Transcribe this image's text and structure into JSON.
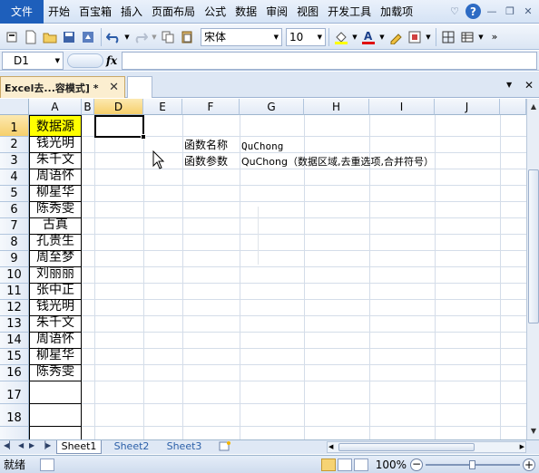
{
  "menu": {
    "file": "文件",
    "items": [
      "开始",
      "百宝箱",
      "插入",
      "页面布局",
      "公式",
      "数据",
      "审阅",
      "视图",
      "开发工具",
      "加载项"
    ]
  },
  "toolbar": {
    "font_name": "宋体",
    "font_size": "10"
  },
  "formula_bar": {
    "cell_ref": "D1",
    "fx": "fx",
    "formula": ""
  },
  "doc_tab": {
    "title": "Excel去...容模式] *"
  },
  "grid": {
    "columns": [
      "A",
      "B",
      "D",
      "E",
      "F",
      "G",
      "H",
      "I",
      "J"
    ],
    "active_column": "D",
    "rows": [
      "1",
      "2",
      "3",
      "4",
      "5",
      "6",
      "7",
      "8",
      "9",
      "10",
      "11",
      "12",
      "13",
      "14",
      "15",
      "16",
      "17",
      "18"
    ],
    "active_row": "1",
    "column_a": [
      "数据源",
      "钱光明",
      "朱千文",
      "周语怀",
      "柳星华",
      "陈秀雯",
      "古真",
      "孔贵生",
      "周至梦",
      "刘丽丽",
      "张中正",
      "钱光明",
      "朱千文",
      "周语怀",
      "柳星华",
      "陈秀雯",
      "",
      ""
    ],
    "f2": "函数名称",
    "g2": "QuChong",
    "f3": "函数参数",
    "g3": "QuChong（数据区域,去重选项,合并符号）"
  },
  "sheets": {
    "tabs": [
      "Sheet1",
      "Sheet2",
      "Sheet3"
    ],
    "active": "Sheet1"
  },
  "status": {
    "ready": "就绪",
    "zoom": "100%"
  },
  "colors": {
    "menu_file_bg": "#1e5fbb",
    "header_highlight": "#f6cf6b",
    "source_header_fill": "#ffff00"
  }
}
